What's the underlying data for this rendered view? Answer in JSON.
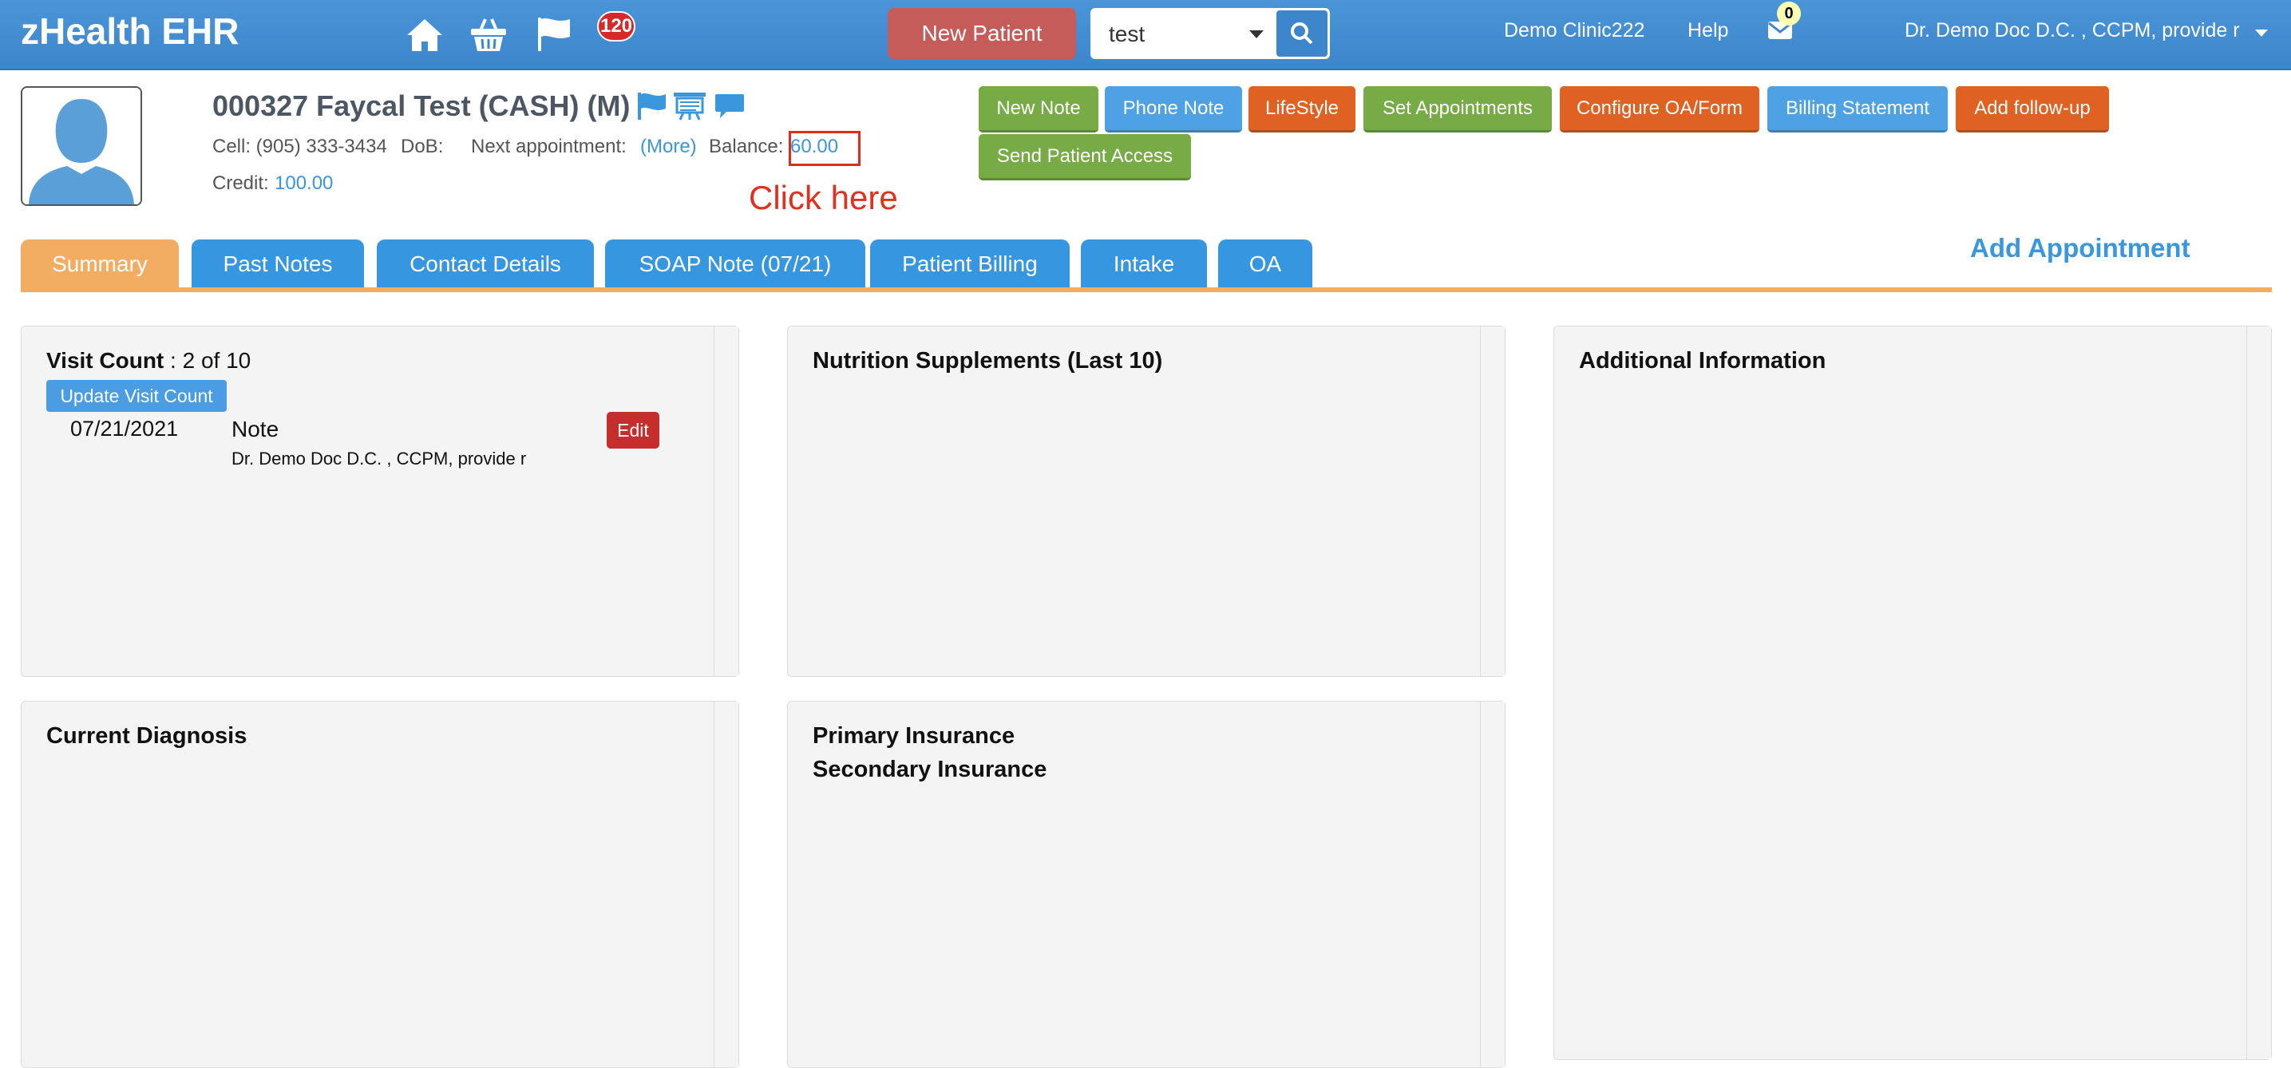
{
  "app": {
    "title": "zHealth EHR"
  },
  "topbar": {
    "notifications_count": "120",
    "new_patient_label": "New Patient",
    "search_value": "test",
    "clinic": "Demo Clinic222",
    "help": "Help",
    "mail_count": "0",
    "user": "Dr. Demo Doc D.C. , CCPM, provide r"
  },
  "patient": {
    "name": "000327 Faycal Test  (CASH) (M)",
    "cell": "Cell: (905) 333-3434",
    "dob_label": "DoB:",
    "next_appt_label": "Next appointment:",
    "next_appt_link": "(More)",
    "balance_label": "Balance:",
    "balance_value": "60.00",
    "credit_label": "Credit:",
    "credit_value": "100.00"
  },
  "annotation": "Click here",
  "actions": [
    {
      "label": "New Note",
      "color": "green"
    },
    {
      "label": "Phone Note",
      "color": "blue"
    },
    {
      "label": "LifeStyle",
      "color": "orange"
    },
    {
      "label": "Set Appointments",
      "color": "green"
    },
    {
      "label": "Configure OA/Form",
      "color": "orange"
    },
    {
      "label": "Billing Statement",
      "color": "blue"
    },
    {
      "label": "Add follow-up",
      "color": "orange"
    },
    {
      "label": "Send Patient Access",
      "color": "green"
    }
  ],
  "tabs": [
    {
      "label": "Summary",
      "active": true
    },
    {
      "label": "Past Notes"
    },
    {
      "label": "Contact Details"
    },
    {
      "label": "SOAP Note (07/21)"
    },
    {
      "label": "Patient Billing"
    },
    {
      "label": "Intake"
    },
    {
      "label": "OA"
    }
  ],
  "add_appointment": "Add Appointment",
  "visits": {
    "label": "Visit Count",
    "count": " : 2 of 10",
    "update_label": "Update Visit Count",
    "entries": [
      {
        "date": "07/21/2021",
        "type": "Note",
        "provider": "Dr. Demo Doc D.C. , CCPM, provide r",
        "edit_label": "Edit"
      }
    ]
  },
  "panels": {
    "nutrition": "Nutrition Supplements (Last 10)",
    "additional": "Additional Information",
    "diagnosis": "Current Diagnosis",
    "primary_ins": "Primary Insurance",
    "secondary_ins": "Secondary Insurance"
  },
  "colors": {
    "topbar": "#3d86cb",
    "tab": "#3796e0",
    "tab_active": "#f3ad63",
    "link": "#3a96dd"
  }
}
